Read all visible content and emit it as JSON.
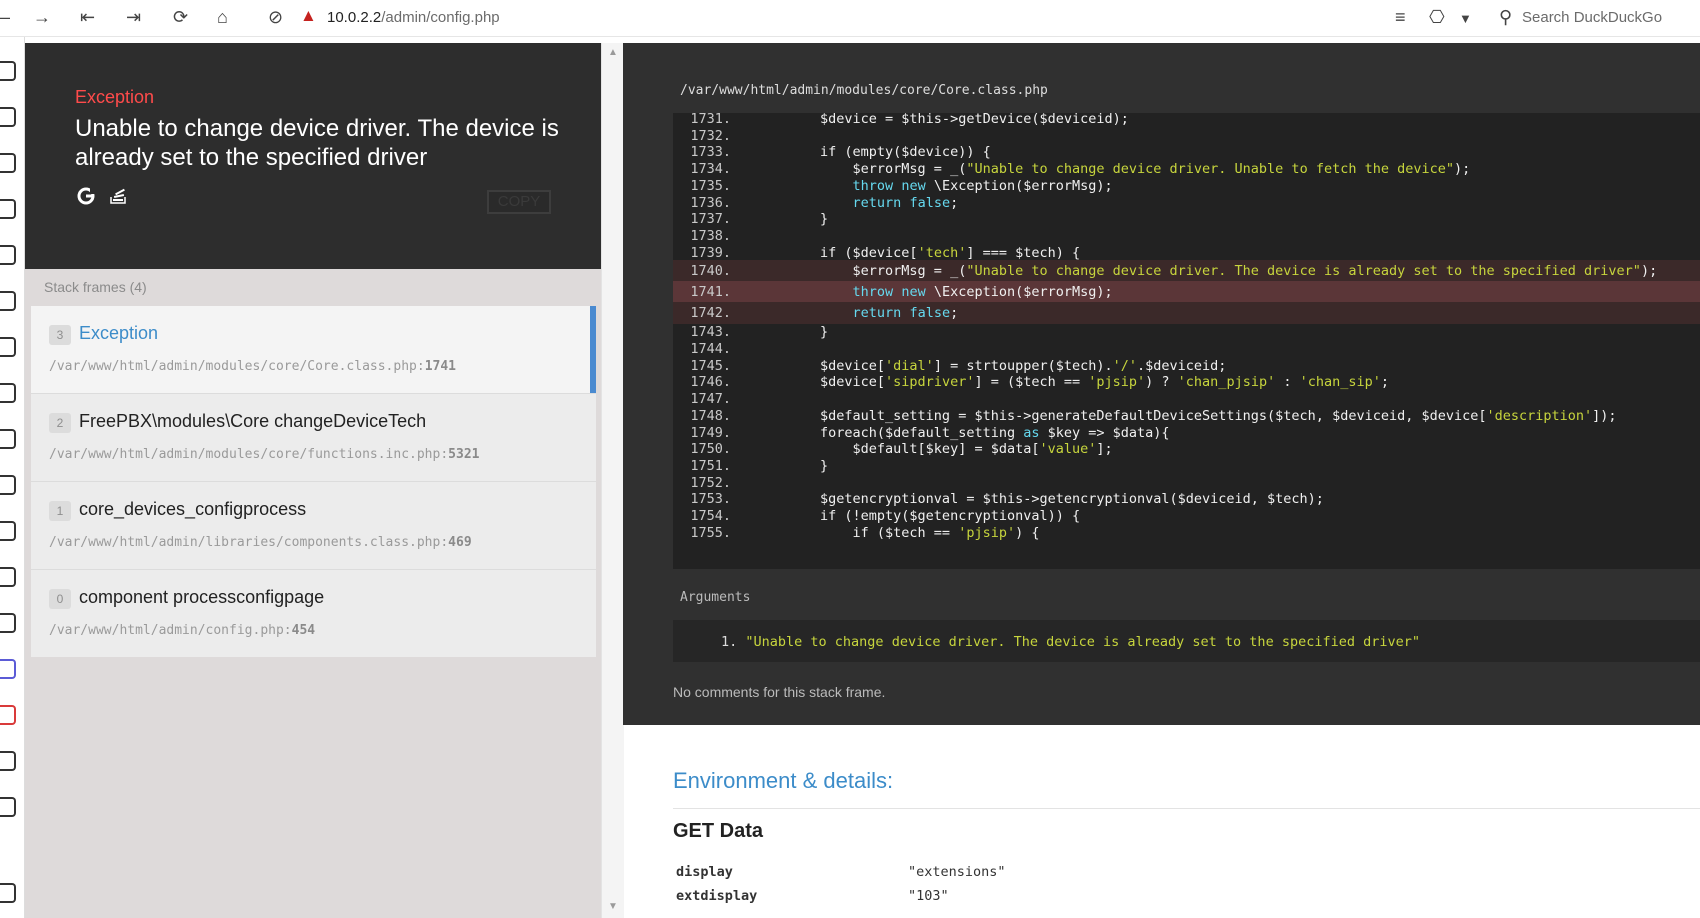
{
  "browser": {
    "url_host": "10.0.2.2",
    "url_path": "/admin/config.php",
    "search_placeholder": "Search DuckDuckGo",
    "toolbar_icons": [
      "back-icon",
      "forward-icon",
      "first-icon",
      "last-icon",
      "reload-icon",
      "home-icon",
      "tracking-icon",
      "warning-icon",
      "reader-icon",
      "bookmark-icon",
      "menu-icon",
      "search-icon"
    ]
  },
  "exception": {
    "label": "Exception",
    "message": "Unable to change device driver. The device is already set to the specified driver",
    "copy_label": "COPY",
    "icons": [
      "google-icon",
      "stackoverflow-icon"
    ]
  },
  "frames": {
    "title": "Stack frames (4)",
    "items": [
      {
        "num": "3",
        "cls": "Exception",
        "file": "/var/www/html/admin/modules/core/Core.class.php:",
        "line": "1741",
        "active": true
      },
      {
        "num": "2",
        "cls": "FreePBX\\modules\\Core changeDeviceTech",
        "file": "/var/www/html/admin/modules/core/functions.inc.php:",
        "line": "5321",
        "active": false
      },
      {
        "num": "1",
        "cls": "core_devices_configprocess",
        "file": "/var/www/html/admin/libraries/components.class.php:",
        "line": "469",
        "active": false
      },
      {
        "num": "0",
        "cls": "component processconfigpage",
        "file": "/var/www/html/admin/config.php:",
        "line": "454",
        "active": false
      }
    ]
  },
  "code": {
    "path": "/var/www/html/admin/modules/core/Core.class.php",
    "lines": [
      {
        "n": "1731.",
        "t": "        $device = $this->getDevice($deviceid);"
      },
      {
        "n": "1732.",
        "t": ""
      },
      {
        "n": "1733.",
        "t": "        if (empty($device)) {"
      },
      {
        "n": "1734.",
        "t": "            $errorMsg = _(\"Unable to change device driver. Unable to fetch the device\");"
      },
      {
        "n": "1735.",
        "t": "            throw new \\Exception($errorMsg);"
      },
      {
        "n": "1736.",
        "t": "            return false;"
      },
      {
        "n": "1737.",
        "t": "        }"
      },
      {
        "n": "1738.",
        "t": ""
      },
      {
        "n": "1739.",
        "t": "        if ($device['tech'] === $tech) {"
      },
      {
        "n": "1740.",
        "t": "            $errorMsg = _(\"Unable to change device driver. The device is already set to the specified driver\");"
      },
      {
        "n": "1741.",
        "t": "            throw new \\Exception($errorMsg);"
      },
      {
        "n": "1742.",
        "t": "            return false;"
      },
      {
        "n": "1743.",
        "t": "        }"
      },
      {
        "n": "1744.",
        "t": ""
      },
      {
        "n": "1745.",
        "t": "        $device['dial'] = strtoupper($tech).'/'.$deviceid;"
      },
      {
        "n": "1746.",
        "t": "        $device['sipdriver'] = ($tech == 'pjsip') ? 'chan_pjsip' : 'chan_sip';"
      },
      {
        "n": "1747.",
        "t": ""
      },
      {
        "n": "1748.",
        "t": "        $default_setting = $this->generateDefaultDeviceSettings($tech, $deviceid, $device['description']);"
      },
      {
        "n": "1749.",
        "t": "        foreach($default_setting as $key => $data){"
      },
      {
        "n": "1750.",
        "t": "            $default[$key] = $data['value'];"
      },
      {
        "n": "1751.",
        "t": "        }"
      },
      {
        "n": "1752.",
        "t": ""
      },
      {
        "n": "1753.",
        "t": "        $getencryptionval = $this->getencryptionval($deviceid, $tech);"
      },
      {
        "n": "1754.",
        "t": "        if (!empty($getencryptionval)) {"
      },
      {
        "n": "1755.",
        "t": "            if ($tech == 'pjsip') {"
      }
    ]
  },
  "arguments": {
    "title": "Arguments",
    "items": [
      "1. \"Unable to change device driver. The device is already set to the specified driver\""
    ]
  },
  "no_comments": "No comments for this stack frame.",
  "environment": {
    "title": "Environment & details:",
    "get_title": "GET Data",
    "get_data": [
      {
        "k": "display",
        "v": "\"extensions\""
      },
      {
        "k": "extdisplay",
        "v": "\"103\""
      }
    ]
  }
}
